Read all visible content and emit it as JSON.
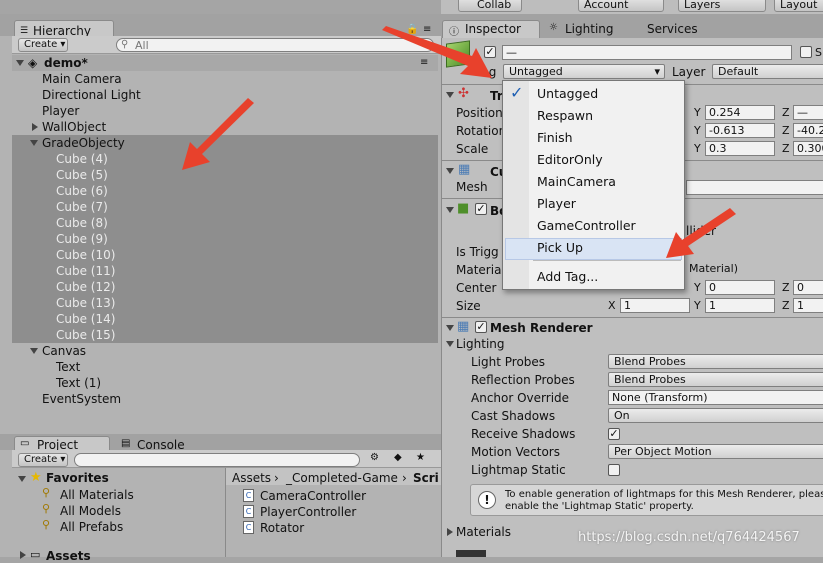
{
  "topbar": {
    "collab": "Collab",
    "account": "Account",
    "layers": "Layers",
    "layout": "Layout"
  },
  "hierarchy": {
    "tab": "Hierarchy",
    "create": "Create",
    "search_placeholder": "All",
    "scene": "demo*",
    "items": [
      "Main Camera",
      "Directional Light",
      "Player",
      "WallObject",
      "GradeObjecty",
      "Cube (4)",
      "Cube (5)",
      "Cube (6)",
      "Cube (7)",
      "Cube (8)",
      "Cube (9)",
      "Cube (10)",
      "Cube (11)",
      "Cube (12)",
      "Cube (13)",
      "Cube (14)",
      "Cube (15)",
      "Canvas",
      "Text",
      "Text (1)",
      "EventSystem"
    ]
  },
  "project": {
    "tabs": [
      "Project",
      "Console"
    ],
    "create": "Create",
    "favorites": "Favorites",
    "fav_items": [
      "All Materials",
      "All Models",
      "All Prefabs"
    ],
    "assets_root": "Assets",
    "breadcrumb": [
      "Assets",
      "_Completed-Game",
      "Scri"
    ],
    "files": [
      "CameraController",
      "PlayerController",
      "Rotator"
    ]
  },
  "inspector": {
    "tabs": [
      "Inspector",
      "Lighting",
      "Services"
    ],
    "name_value": "—",
    "static": "S",
    "tag_label": "Tag",
    "tag_value": "Untagged",
    "layer_label": "Layer",
    "layer_value": "Default",
    "transform": {
      "title": "Tr",
      "rows": [
        {
          "label": "Position",
          "y": "0.254",
          "z": "—"
        },
        {
          "label": "Rotation",
          "y": "-0.613",
          "z": "-40.2"
        },
        {
          "label": "Scale",
          "y": "0.3",
          "z": "0.300"
        }
      ]
    },
    "mesh_filter": {
      "title": "Cu",
      "mesh_label": "Mesh"
    },
    "box_collider": {
      "title": "Bo",
      "collider_suffix": "llider",
      "is_trigger": "Is Trigg",
      "material_label": "Material",
      "material_value": "Material)",
      "center_label": "Center",
      "center": {
        "y": "0",
        "z": "0"
      },
      "size_label": "Size",
      "size": {
        "x": "1",
        "y": "1",
        "z": "1"
      }
    },
    "mesh_renderer": {
      "title": "Mesh Renderer",
      "lighting": "Lighting",
      "rows": [
        {
          "label": "Light Probes",
          "value": "Blend Probes"
        },
        {
          "label": "Reflection Probes",
          "value": "Blend Probes"
        },
        {
          "label": "Anchor Override",
          "value": "None (Transform)"
        },
        {
          "label": "Cast Shadows",
          "value": "On"
        },
        {
          "label": "Receive Shadows",
          "value": ""
        },
        {
          "label": "Motion Vectors",
          "value": "Per Object Motion"
        },
        {
          "label": "Lightmap Static",
          "value": ""
        }
      ],
      "info": "To enable generation of lightmaps for this Mesh Renderer, pleas enable the 'Lightmap Static' property.",
      "materials": "Materials"
    }
  },
  "tag_menu": {
    "items": [
      "Untagged",
      "Respawn",
      "Finish",
      "EditorOnly",
      "MainCamera",
      "Player",
      "GameController",
      "Pick Up"
    ],
    "add": "Add Tag...",
    "checked": "✓"
  },
  "watermark": "https://blog.csdn.net/q764424567",
  "accent": {
    "arrow": "#e8412c",
    "selected_row": "#8e8e8e",
    "menu_highlight": "#d9e4f4"
  }
}
